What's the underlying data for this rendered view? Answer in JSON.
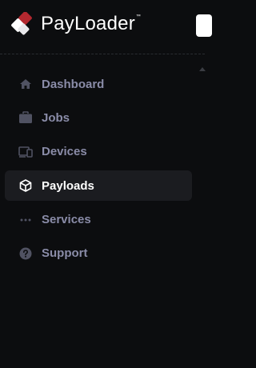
{
  "brand": {
    "name": "PayLoader",
    "trademark": "™"
  },
  "nav": {
    "items": [
      {
        "label": "Dashboard",
        "icon": "home-icon",
        "active": false
      },
      {
        "label": "Jobs",
        "icon": "briefcase-icon",
        "active": false
      },
      {
        "label": "Devices",
        "icon": "devices-icon",
        "active": false
      },
      {
        "label": "Payloads",
        "icon": "package-icon",
        "active": true
      },
      {
        "label": "Services",
        "icon": "dots-icon",
        "active": false
      },
      {
        "label": "Support",
        "icon": "help-icon",
        "active": false
      }
    ]
  },
  "colors": {
    "background": "#0c0d0f",
    "active_item_bg": "#1b1c20",
    "inactive_label": "#8a8ca8",
    "active_label": "#ffffff",
    "logo_red": "#b3282f"
  }
}
